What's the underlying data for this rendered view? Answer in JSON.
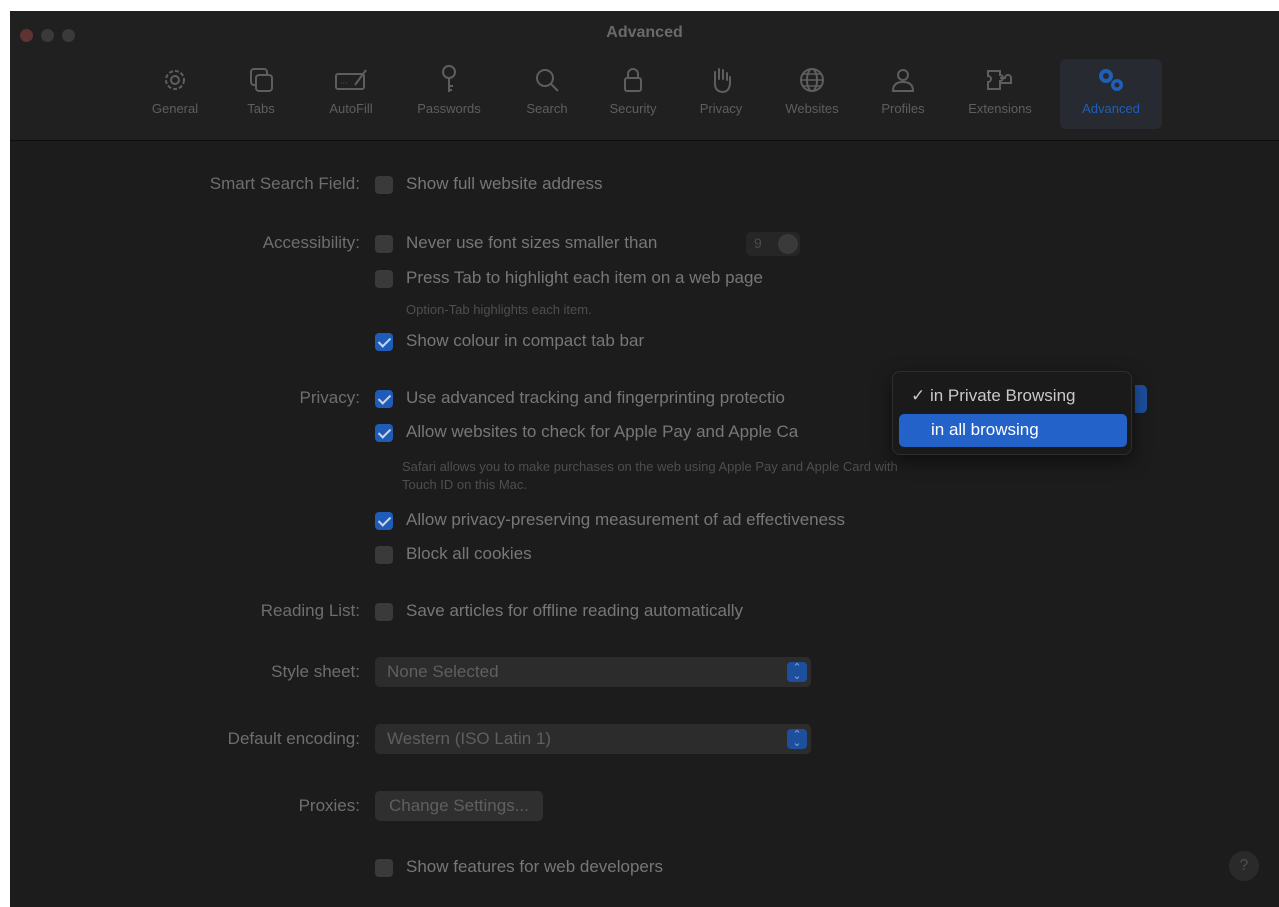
{
  "window": {
    "title": "Advanced"
  },
  "toolbar": {
    "items": [
      {
        "label": "General",
        "icon": "gear-icon"
      },
      {
        "label": "Tabs",
        "icon": "tabs-icon"
      },
      {
        "label": "AutoFill",
        "icon": "autofill-icon"
      },
      {
        "label": "Passwords",
        "icon": "key-icon"
      },
      {
        "label": "Search",
        "icon": "search-icon"
      },
      {
        "label": "Security",
        "icon": "lock-icon"
      },
      {
        "label": "Privacy",
        "icon": "hand-icon"
      },
      {
        "label": "Websites",
        "icon": "globe-icon"
      },
      {
        "label": "Profiles",
        "icon": "person-icon"
      },
      {
        "label": "Extensions",
        "icon": "puzzle-icon"
      },
      {
        "label": "Advanced",
        "icon": "gears-icon"
      }
    ],
    "active": "Advanced"
  },
  "smart_search": {
    "label": "Smart Search Field:",
    "option": "Show full website address",
    "checked": false
  },
  "accessibility": {
    "label": "Accessibility:",
    "font_size_option": "Never use font sizes smaller than",
    "font_size_value": "9",
    "font_size_checked": false,
    "tab_option": "Press Tab to highlight each item on a web page",
    "tab_checked": false,
    "tab_note": "Option-Tab highlights each item.",
    "colour_option": "Show colour in compact tab bar",
    "colour_checked": true
  },
  "privacy": {
    "label": "Privacy:",
    "tracking_option": "Use advanced tracking and fingerprinting protectio",
    "tracking_checked": true,
    "applepay_option": "Allow websites to check for Apple Pay and Apple Ca",
    "applepay_checked": true,
    "applepay_note_line1": "Safari allows you to make purchases on the web using Apple Pay and Apple Card with",
    "applepay_note_line2": "Touch ID on this Mac.",
    "measurement_option": "Allow privacy-preserving measurement of ad effectiveness",
    "measurement_checked": true,
    "cookies_option": "Block all cookies",
    "cookies_checked": false
  },
  "tracking_menu": {
    "options": [
      "✓ in Private Browsing",
      "in all browsing"
    ],
    "highlighted": "in all browsing"
  },
  "reading_list": {
    "label": "Reading List:",
    "option": "Save articles for offline reading automatically",
    "checked": false
  },
  "style_sheet": {
    "label": "Style sheet:",
    "value": "None Selected"
  },
  "encoding": {
    "label": "Default encoding:",
    "value": "Western (ISO Latin 1)"
  },
  "proxies": {
    "label": "Proxies:",
    "button": "Change Settings..."
  },
  "developer": {
    "option": "Show features for web developers",
    "checked": false
  },
  "help": {
    "label": "?"
  },
  "colors": {
    "accent": "#2262c9",
    "background": "#1c1c1c"
  }
}
